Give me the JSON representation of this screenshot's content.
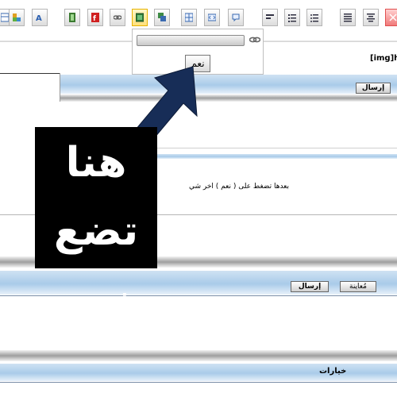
{
  "toolbar": {
    "buttons": [
      {
        "icon": "table-icon",
        "state": "normal"
      },
      {
        "icon": "insert-object-icon",
        "state": "normal"
      },
      {
        "icon": "spell-check-icon",
        "state": "normal"
      },
      {
        "icon": "film-icon",
        "state": "normal"
      },
      {
        "icon": "flash-icon",
        "state": "normal"
      },
      {
        "icon": "link-icon",
        "state": "normal"
      },
      {
        "icon": "image-icon",
        "state": "active"
      },
      {
        "icon": "gallery-icon",
        "state": "normal"
      },
      {
        "icon": "grid-icon",
        "state": "normal"
      },
      {
        "icon": "code-icon",
        "state": "normal"
      },
      {
        "icon": "quote-icon",
        "state": "normal"
      },
      {
        "icon": "align-left-icon",
        "state": "normal"
      },
      {
        "icon": "ordered-list-icon",
        "state": "normal"
      },
      {
        "icon": "unordered-list-icon",
        "state": "normal"
      },
      {
        "icon": "align-justify-icon",
        "state": "normal"
      },
      {
        "icon": "align-center-icon",
        "state": "normal"
      },
      {
        "icon": "align-right-icon",
        "state": "normal"
      },
      {
        "icon": "close-icon",
        "state": "alert"
      }
    ]
  },
  "image_popup": {
    "url_value": "",
    "ok_label": "نعم"
  },
  "editor": {
    "img_tag_text": "[img]h",
    "body_text": "بعدها تضغط على ( نعم ) اخر شي"
  },
  "annotation": {
    "line1": "هنا تضع",
    "line2": "نعم",
    "arrow_color": "#172d57",
    "box_color": "#000000"
  },
  "quick_reply": {
    "send_label": "إرسال"
  },
  "reply_form": {
    "send_label": "إرسال",
    "preview_label": "مُعاينة"
  },
  "options": {
    "label": "خيارات"
  },
  "colors": {
    "band_blue": "#a9cbe9",
    "toolbar_active": "#ffe07a"
  }
}
